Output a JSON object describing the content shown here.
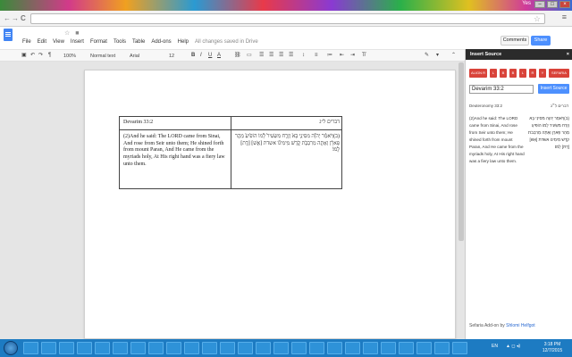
{
  "window": {
    "user_label": "Yes",
    "minimize": "–",
    "maximize": "□",
    "close": "×"
  },
  "browser": {
    "nav_back": "←",
    "nav_forward": "→",
    "reload": "C",
    "star": "☆",
    "menu": "≡"
  },
  "docs": {
    "menus": [
      "File",
      "Edit",
      "View",
      "Insert",
      "Format",
      "Tools",
      "Table",
      "Add-ons",
      "Help"
    ],
    "saved_status": "All changes saved in Drive",
    "comments_label": "Comments",
    "share_label": "Share"
  },
  "toolbar": {
    "zoom": "100%",
    "style": "Normal text",
    "font": "Arial",
    "size": "12",
    "bold": "B",
    "italic": "I",
    "underline": "U",
    "text_color": "A",
    "more": "More",
    "collapse": "⌃"
  },
  "table": {
    "header_en": "Devarim 33:2",
    "header_he": "דברים ל״ג",
    "body_en": "(2)And he said: The LORD came from Sinai, And rose from Seir unto them; He shined forth from mount Paran, And He came from the myriads holy, At His right hand was a fiery law unto them.",
    "body_he": "(ב)וַיֹּאמַ֗ר יְהוָ֞ה מִסִּינַ֥י בָּא֙ וְזָרַ֤ח מִשֵּׂעִיר֙ לָ֔מוֹ הוֹפִ֙יעַ֙ מֵהַ֣ר פָּארָ֔ן וְאָתָ֖ה מֵרִבְבֹ֣ת קֹ֑דֶשׁ מִֽימִינ֕וֹ אשדת [אֵ֥שׁ] [דָּ֖ת] לָֽמוֹ׃"
  },
  "panel": {
    "title": "Insert Source",
    "close": "×",
    "buttons": [
      "ALIGN R",
      "L",
      "B",
      "B",
      "L",
      "R",
      "Y",
      "SEFARIA"
    ],
    "source_input": "Devarim 33:2",
    "insert_label": "Insert Source",
    "source_en_label": "Deuteronomy 33:2",
    "source_he_label": "דברים ל״ג",
    "en_text": "(2)And he said: The LORD came from Sinai, And rose from Seir unto them; He shined forth from mount Paran, And He came from the myriads holy, At His right hand was a fiery law unto them.",
    "he_text": "(ב)וַיֹּאמַר יְהוָה מִסִּינַי בָּא וְזָרַח מִשֵּׂעִיר לָמוֹ הוֹפִיעַ מֵהַר פָּארָן וְאָתָה מֵרִבְבֹת קֹדֶשׁ מִימִינוֹ אשדת [אֵשׁ] [דָּת] לָמוֹ׃",
    "credit_prefix": "Sefaria Add-on by",
    "credit_author": "Shlomi Helfgot"
  },
  "taskbar": {
    "lang": "EN",
    "tray_icons": "▲ ◻ ◂)",
    "time": "3:18 PM",
    "date": "12/7/2015"
  },
  "colors": {
    "accent_blue": "#4d90fe",
    "sefaria_red": "#d9433a",
    "taskbar": "#1d7bc2"
  }
}
